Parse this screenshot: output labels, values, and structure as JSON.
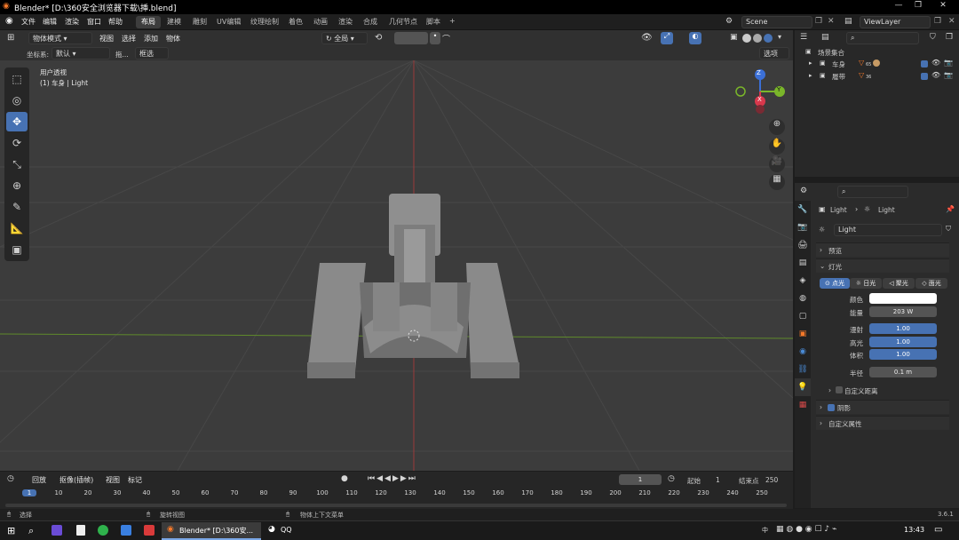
{
  "title": "Blender* [D:\\360安全浏览器下载\\挿.blend]",
  "menu": [
    "文件",
    "编辑",
    "渲染",
    "窗口",
    "帮助"
  ],
  "workspaces": [
    "布局",
    "建模",
    "雕刻",
    "UV编辑",
    "纹理绘制",
    "着色",
    "动画",
    "渲染",
    "合成",
    "几何节点",
    "脚本"
  ],
  "add_tab": "+",
  "scene": "Scene",
  "view_layer": "ViewLayer",
  "header": {
    "mode": "物体模式",
    "view": "视图",
    "select": "选择",
    "add": "添加",
    "object": "物体",
    "transform_global": "全局",
    "coord_label": "坐标系:",
    "coord_value": "默认",
    "drag": "拖...",
    "select_box": "框选",
    "options": "选项"
  },
  "viewport": {
    "persp": "用户透视",
    "object_info": "(1) 车身 | Light"
  },
  "gizmo": {
    "x": "X",
    "y": "Y",
    "z": "Z"
  },
  "outliner": {
    "root": "场景集合",
    "items": [
      {
        "name": "车身",
        "count": "65"
      },
      {
        "name": "履带",
        "count": "36"
      }
    ]
  },
  "props": {
    "breadcrumb_obj": "Light",
    "breadcrumb_data": "Light",
    "data_name": "Light",
    "preview": "预览",
    "light": "灯光",
    "light_types": [
      "点光",
      "日光",
      "聚光",
      "面光"
    ],
    "color_label": "颜色",
    "power_label": "能量",
    "power": "203 W",
    "diffuse_label": "漫射",
    "diffuse": "1.00",
    "specular_label": "高光",
    "specular": "1.00",
    "volume_label": "体积",
    "volume": "1.00",
    "radius_label": "半径",
    "radius": "0.1 m",
    "custom_distance": "自定义距离",
    "shadow": "阴影",
    "custom_props": "自定义属性"
  },
  "timeline": {
    "playback": "回放",
    "keying": "抠像(插帧)",
    "view": "视图",
    "marker": "标记",
    "current": "1",
    "start_label": "起始",
    "start": "1",
    "end_label": "结束点",
    "end": "250",
    "ticks": [
      "1",
      "10",
      "20",
      "30",
      "40",
      "50",
      "60",
      "70",
      "80",
      "90",
      "100",
      "110",
      "120",
      "130",
      "140",
      "150",
      "160",
      "170",
      "180",
      "190",
      "200",
      "210",
      "220",
      "230",
      "240",
      "250"
    ]
  },
  "status": {
    "select": "选择",
    "rotate": "旋转视图",
    "context": "物体上下文菜单",
    "version": "3.6.1"
  },
  "taskbar": {
    "blender": "Blender* [D:\\360安...",
    "qq": "QQ",
    "time": "13:43",
    "ime": "中"
  }
}
